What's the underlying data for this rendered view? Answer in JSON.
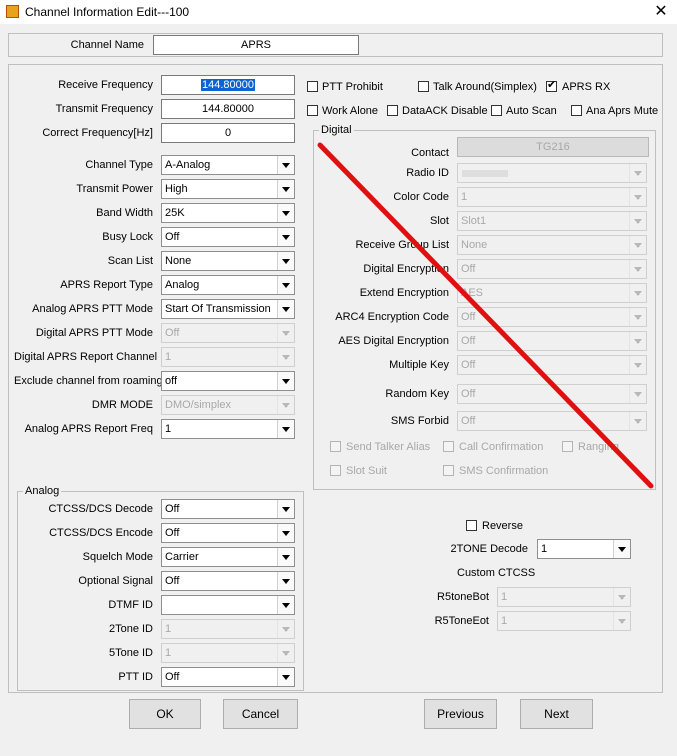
{
  "window": {
    "title": "Channel Information Edit---100"
  },
  "channel_name": {
    "label": "Channel Name",
    "value": "APRS"
  },
  "freq": [
    {
      "label": "Receive Frequency",
      "value": "144.80000"
    },
    {
      "label": "Transmit Frequency",
      "value": "144.80000"
    },
    {
      "label": "Correct Frequency[Hz]",
      "value": "0"
    }
  ],
  "checks": [
    {
      "label": "PTT Prohibit",
      "checked": false
    },
    {
      "label": "Talk Around(Simplex)",
      "checked": false
    },
    {
      "label": "APRS RX",
      "checked": true
    },
    {
      "label": "Work Alone",
      "checked": false
    },
    {
      "label": "DataACK Disable",
      "checked": false
    },
    {
      "label": "Auto Scan",
      "checked": false
    },
    {
      "label": "Ana Aprs Mute",
      "checked": false
    }
  ],
  "settings": [
    {
      "label": "Channel Type",
      "value": "A-Analog",
      "disabled": false
    },
    {
      "label": "Transmit Power",
      "value": "High",
      "disabled": false
    },
    {
      "label": "Band Width",
      "value": "25K",
      "disabled": false
    },
    {
      "label": "Busy Lock",
      "value": "Off",
      "disabled": false
    },
    {
      "label": "Scan List",
      "value": "None",
      "disabled": false
    },
    {
      "label": "APRS Report Type",
      "value": "Analog",
      "disabled": false
    },
    {
      "label": "Analog APRS PTT Mode",
      "value": "Start Of Transmission",
      "disabled": false
    },
    {
      "label": "Digital APRS PTT Mode",
      "value": "Off",
      "disabled": true
    },
    {
      "label": "Digital APRS Report Channel",
      "value": "1",
      "disabled": true
    },
    {
      "label": "Exclude channel from roaming",
      "value": "off",
      "disabled": false
    },
    {
      "label": "DMR MODE",
      "value": "DMO/simplex",
      "disabled": true
    },
    {
      "label": "Analog APRS Report Freq",
      "value": "1",
      "disabled": false
    }
  ],
  "digital": {
    "title": "Digital",
    "contact": {
      "label": "Contact",
      "value": "TG216"
    },
    "fields": [
      {
        "label": "Radio ID",
        "value": ""
      },
      {
        "label": "Color Code",
        "value": "1"
      },
      {
        "label": "Slot",
        "value": "Slot1"
      },
      {
        "label": "Receive Group List",
        "value": "None"
      },
      {
        "label": "Digital Encryption",
        "value": "Off"
      },
      {
        "label": "Extend Encryption",
        "value": "AES"
      },
      {
        "label": "ARC4 Encryption Code",
        "value": "Off"
      },
      {
        "label": "AES Digital Encryption",
        "value": "Off"
      },
      {
        "label": "Multiple Key",
        "value": "Off"
      },
      {
        "label": "Random Key",
        "value": "Off"
      },
      {
        "label": "SMS Forbid",
        "value": "Off"
      }
    ],
    "checks": [
      {
        "label": "Send Talker Alias"
      },
      {
        "label": "Call Confirmation"
      },
      {
        "label": "Ranging"
      },
      {
        "label": "Slot Suit"
      },
      {
        "label": "SMS Confirmation"
      }
    ]
  },
  "analog": {
    "title": "Analog",
    "fields": [
      {
        "label": "CTCSS/DCS Decode",
        "value": "Off",
        "disabled": false
      },
      {
        "label": "CTCSS/DCS Encode",
        "value": "Off",
        "disabled": false
      },
      {
        "label": "Squelch Mode",
        "value": "Carrier",
        "disabled": false
      },
      {
        "label": "Optional Signal",
        "value": "Off",
        "disabled": false
      },
      {
        "label": "DTMF ID",
        "value": "",
        "disabled": false
      },
      {
        "label": "2Tone ID",
        "value": "1",
        "disabled": true
      },
      {
        "label": "5Tone ID",
        "value": "1",
        "disabled": true
      },
      {
        "label": "PTT ID",
        "value": "Off",
        "disabled": false
      }
    ],
    "reverse": {
      "label": "Reverse",
      "checked": false
    },
    "twotone_decode": {
      "label": "2TONE Decode",
      "value": "1"
    },
    "custom_ctcss": {
      "label": "Custom CTCSS"
    },
    "r5tone_bot": {
      "label": "R5toneBot",
      "value": "1"
    },
    "r5tone_eot": {
      "label": "R5ToneEot",
      "value": "1"
    }
  },
  "buttons": {
    "ok": "OK",
    "cancel": "Cancel",
    "previous": "Previous",
    "next": "Next"
  },
  "annotation": {
    "color": "#e01010"
  }
}
